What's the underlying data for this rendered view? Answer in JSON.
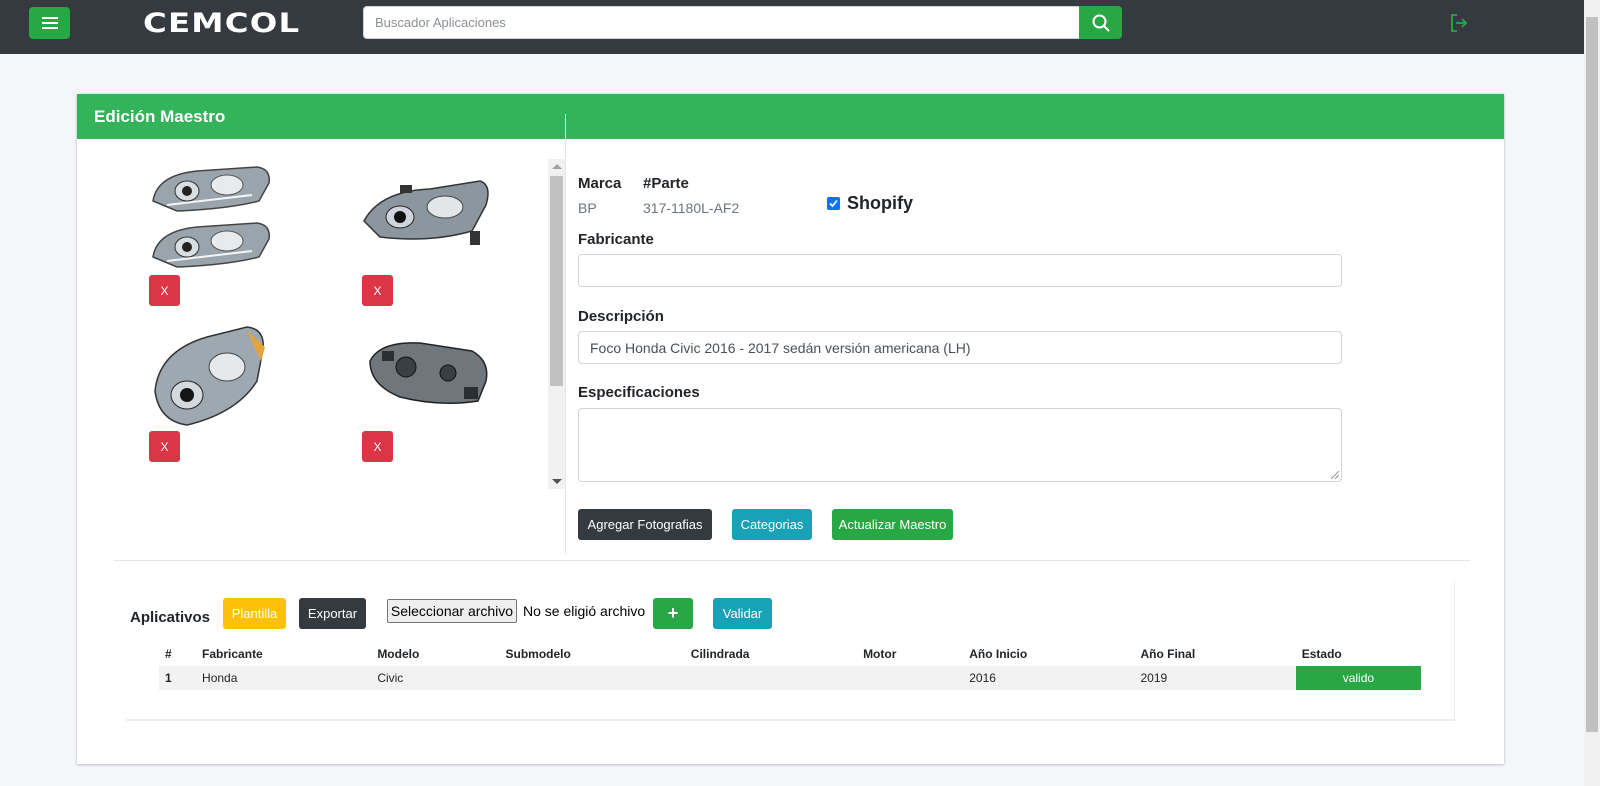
{
  "header": {
    "logo": "CEMCOL",
    "search_placeholder": "Buscador Aplicaciones"
  },
  "card": {
    "title": "Edición Maestro"
  },
  "images": [
    {
      "name": "headlight-pair-photo",
      "delete_label": "X"
    },
    {
      "name": "headlight-side-photo",
      "delete_label": "X"
    },
    {
      "name": "headlight-angle-photo",
      "delete_label": "X"
    },
    {
      "name": "headlight-rear-photo",
      "delete_label": "X"
    }
  ],
  "form": {
    "marca_label": "Marca",
    "marca_value": "BP",
    "parte_label": "#Parte",
    "parte_value": "317-1180L-AF2",
    "shopify_label": "Shopify",
    "shopify_checked": true,
    "fabricante_label": "Fabricante",
    "fabricante_value": "",
    "descripcion_label": "Descripción",
    "descripcion_value": "Foco Honda Civic 2016 - 2017 sedán versión americana (LH)",
    "especificaciones_label": "Especificaciones",
    "especificaciones_value": "",
    "buttons": {
      "agregar": "Agregar Fotografias",
      "categorias": "Categorias",
      "actualizar": "Actualizar Maestro"
    }
  },
  "aplicativos": {
    "title": "Aplicativos",
    "plantilla": "Plantilla",
    "exportar": "Exportar",
    "file_button": "Seleccionar archivo",
    "file_status": "No se eligió archivo",
    "add_label": "+",
    "validar": "Validar",
    "columns": [
      "#",
      "Fabricante",
      "Modelo",
      "Submodelo",
      "Cilindrada",
      "Motor",
      "Año Inicio",
      "Año Final",
      "Estado"
    ],
    "rows": [
      {
        "num": "1",
        "fabricante": "Honda",
        "modelo": "Civic",
        "submodelo": "",
        "cilindrada": "",
        "motor": "",
        "inicio": "2016",
        "final": "2019",
        "estado": "valido"
      }
    ]
  },
  "colors": {
    "primary": "#28a745",
    "header_bg": "#343a40",
    "danger": "#dc3545",
    "info": "#17a2b8",
    "warning": "#ffc107"
  }
}
